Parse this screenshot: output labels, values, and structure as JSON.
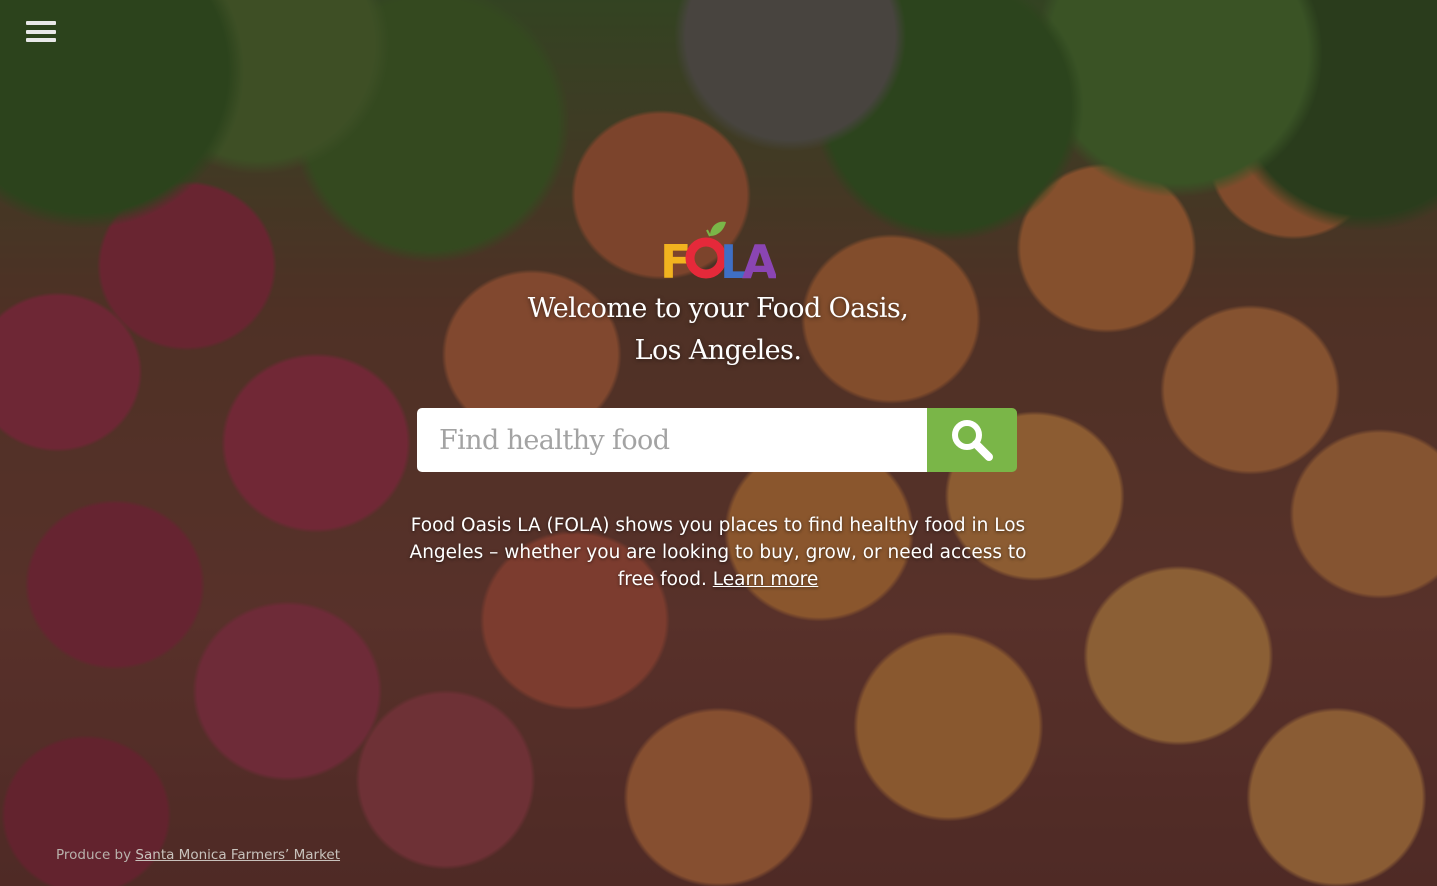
{
  "menu": {
    "icon": "hamburger-menu-icon"
  },
  "logo": {
    "text": "FOLA",
    "letters": [
      "F",
      "O",
      "L",
      "A"
    ],
    "colors": {
      "f": "#f2b31f",
      "o": "#e5293a",
      "l": "#3f6fc4",
      "a": "#8a45b3",
      "leaf": "#7ab648"
    }
  },
  "headline": {
    "line1": "Welcome to your Food Oasis,",
    "line2": "Los Angeles."
  },
  "search": {
    "placeholder": "Find healthy food",
    "value": "",
    "button_icon": "search-icon",
    "button_color": "#7ab648"
  },
  "description": {
    "text": "Food Oasis LA (FOLA) shows you places to find healthy food in Los Angeles – whether you are looking to buy, grow, or need access to free food.",
    "link_label": "Learn more"
  },
  "credit": {
    "prefix": "Produce by",
    "link_label": "Santa Monica Farmers’ Market"
  }
}
